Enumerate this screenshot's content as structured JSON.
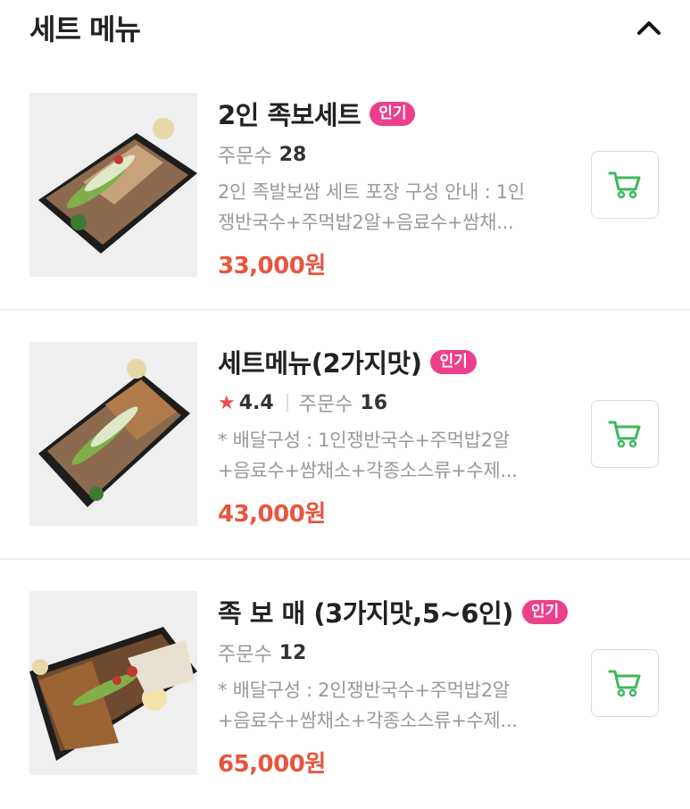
{
  "section": {
    "title": "세트 메뉴",
    "collapse_icon": "chevron-up-icon"
  },
  "colors": {
    "price": "#e8553f",
    "badge": "#ee3f8c",
    "cart_icon": "#3cb95a",
    "star": "#e8504f"
  },
  "items": [
    {
      "name": "2인 족보세트",
      "badge": "인기",
      "order_label": "주문수",
      "order_count": "28",
      "desc_line1": "2인 족발보쌈 세트 포장 구성 안내 : 1인",
      "desc_line2": "쟁반국수+주먹밥2알+음료수+쌈채...",
      "price": "33,000원",
      "cart_icon": "cart-icon"
    },
    {
      "name": "세트메뉴(2가지맛)",
      "badge": "인기",
      "rating_icon": "★",
      "rating": "4.4",
      "order_label": "주문수",
      "order_count": "16",
      "desc_line1": "* 배달구성 : 1인쟁반국수+주먹밥2알",
      "desc_line2": "+음료수+쌈채소+각종소스류+수제...",
      "price": "43,000원",
      "cart_icon": "cart-icon"
    },
    {
      "name": "족 보 매 (3가지맛,5~6인)",
      "badge": "인기",
      "order_label": "주문수",
      "order_count": "12",
      "desc_line1": "* 배달구성 : 2인쟁반국수+주먹밥2알",
      "desc_line2": "+음료수+쌈채소+각종소스류+수제...",
      "price": "65,000원",
      "cart_icon": "cart-icon"
    }
  ]
}
